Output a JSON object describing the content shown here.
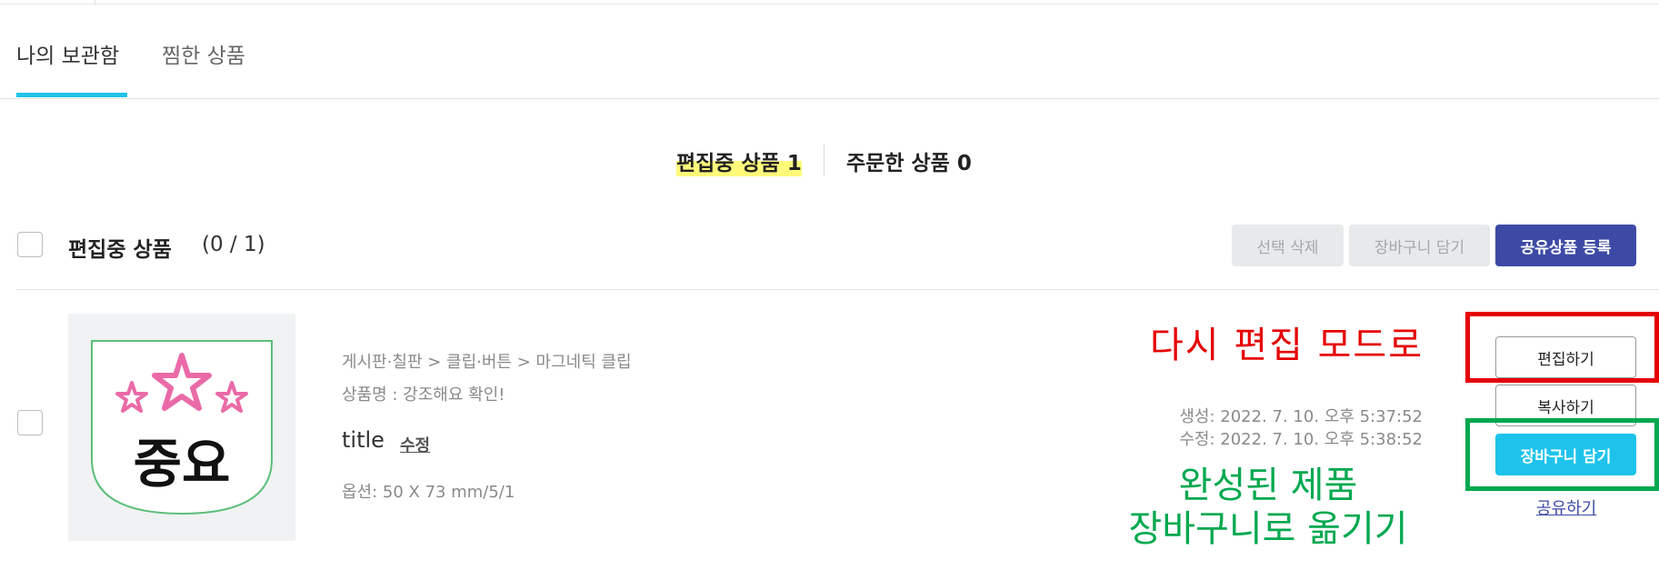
{
  "tabs": [
    {
      "label": "나의 보관함",
      "active": true
    },
    {
      "label": "찜한 상품",
      "active": false
    }
  ],
  "counts": {
    "editing": "편집중 상품 1",
    "ordered": "주문한 상품 0"
  },
  "section": {
    "title": "편집중 상품",
    "count": "(0 / 1)"
  },
  "actions": {
    "delete_selected": "선택 삭제",
    "add_to_cart": "장바구니 담기",
    "register_shared": "공유상품 등록"
  },
  "product": {
    "thumbnail": {
      "star_text": "☆",
      "main_text": "중요",
      "star_color": "#ea6aa8"
    },
    "breadcrumb": "게시판·칠판 > 클립·버튼 > 마그네틱 클립",
    "name": "상품명 : 강조해요 확인!",
    "title": "title",
    "title_edit": "수정",
    "option": "옵션: 50 X 73 mm/5/1",
    "created": "생성: 2022. 7. 10. 오후 5:37:52",
    "modified": "수정: 2022. 7. 10. 오후 5:38:52"
  },
  "item_actions": {
    "edit": "편집하기",
    "copy": "복사하기",
    "cart": "장바구니 담기",
    "share": "공유하기"
  },
  "annotations": {
    "red": "다시 편집 모드로",
    "green_line1": "완성된 제품",
    "green_line2": "장바구니로 옮기기"
  },
  "colors": {
    "accent": "#1ec3e8",
    "navy": "#3d4aa5",
    "annotation_red": "#e60000",
    "annotation_green": "#00a84f",
    "highlight": "#fff97a"
  }
}
